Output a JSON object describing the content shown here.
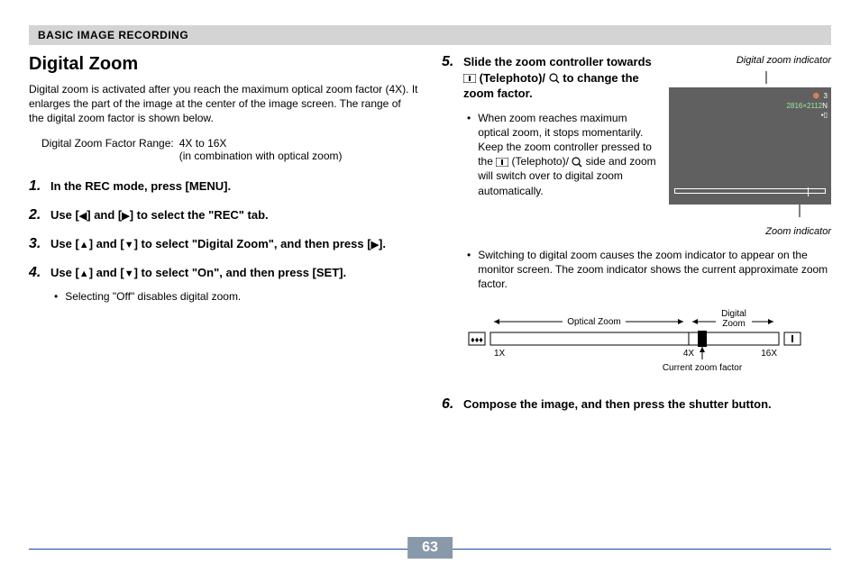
{
  "header": "BASIC IMAGE RECORDING",
  "title": "Digital Zoom",
  "intro": "Digital zoom is activated after you reach the maximum optical zoom factor (4X). It enlarges the part of the image at the center of the image screen. The range of the digital zoom factor is shown below.",
  "range": {
    "label": "Digital Zoom Factor Range:",
    "value": "4X to 16X",
    "note": "(in combination with optical zoom)"
  },
  "steps": {
    "s1": "In the REC mode, press [MENU].",
    "s2a": "Use [",
    "s2b": "] and [",
    "s2c": "] to select the \"REC\" tab.",
    "s3a": "Use [",
    "s3b": "] and [",
    "s3c": "] to select \"Digital Zoom\", and then press [",
    "s3d": "].",
    "s4a": "Use [",
    "s4b": "] and [",
    "s4c": "] to select \"On\", and then press [SET].",
    "s4_sub": "Selecting \"Off\" disables digital zoom.",
    "s5a": "Slide the zoom controller towards ",
    "s5b": " (Telephoto)/ ",
    "s5c": " to change the zoom factor.",
    "s5_sub1a": "When zoom reaches maximum optical zoom, it stops momentarily. Keep the zoom controller pressed to the ",
    "s5_sub1b": " (Telephoto)/ ",
    "s5_sub1c": " side and zoom will switch over to digital zoom automatically.",
    "s5_sub2": "Switching to digital zoom causes the zoom indicator to appear on the monitor screen. The zoom indicator shows the current approximate zoom factor.",
    "s6": "Compose the image, and then press the shutter button."
  },
  "screen": {
    "top_caption": "Digital zoom indicator",
    "bottom_caption": "Zoom indicator",
    "count": "3",
    "res": "2816×2112",
    "quality": "N"
  },
  "diagram": {
    "optical": "Optical Zoom",
    "digital": "Digital\nZoom",
    "x1": "1X",
    "x4": "4X",
    "x16": "16X",
    "current": "Current zoom factor"
  },
  "page_number": "63"
}
